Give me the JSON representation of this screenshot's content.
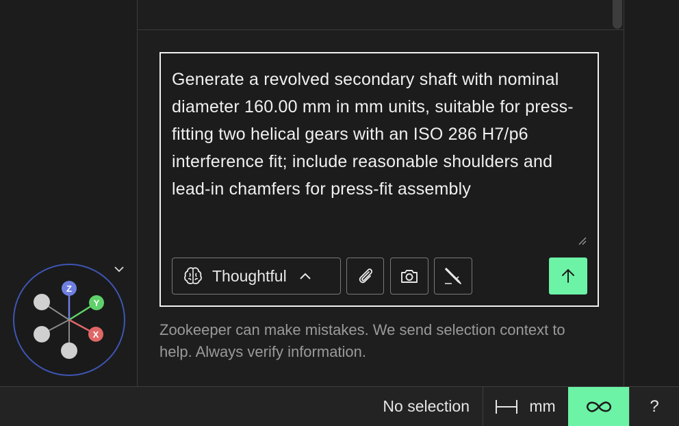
{
  "composer": {
    "prompt_text": "Generate a revolved secondary shaft with nominal diameter 160.00 mm in mm units, suitable for press-fitting two helical gears with an ISO 286 H7/p6 interference fit; include reasonable shoulders and lead-in chamfers for press-fit assembly",
    "mode_label": "Thoughtful",
    "icons": {
      "mode": "brain-icon",
      "mode_toggle": "chevron-up-icon",
      "attach": "paperclip-icon",
      "screenshot": "camera-icon",
      "sketch": "pencil-icon",
      "send": "arrow-up-icon"
    }
  },
  "disclaimer": "Zookeeper can make mistakes. We send selection context to help. Always verify information.",
  "status_bar": {
    "selection": "No selection",
    "units": "mm",
    "help": "?",
    "icons": {
      "units": "ruler-width-icon",
      "mode": "infinity-icon"
    }
  },
  "gizmo": {
    "axes": {
      "z": "Z",
      "y": "Y",
      "x": "X"
    },
    "colors": {
      "z": "#6f7fe0",
      "y": "#5fd16a",
      "x": "#e06767"
    }
  },
  "colors": {
    "accent": "#6cf3a5",
    "background": "#1c1c1c",
    "border": "#f2f2f2"
  }
}
